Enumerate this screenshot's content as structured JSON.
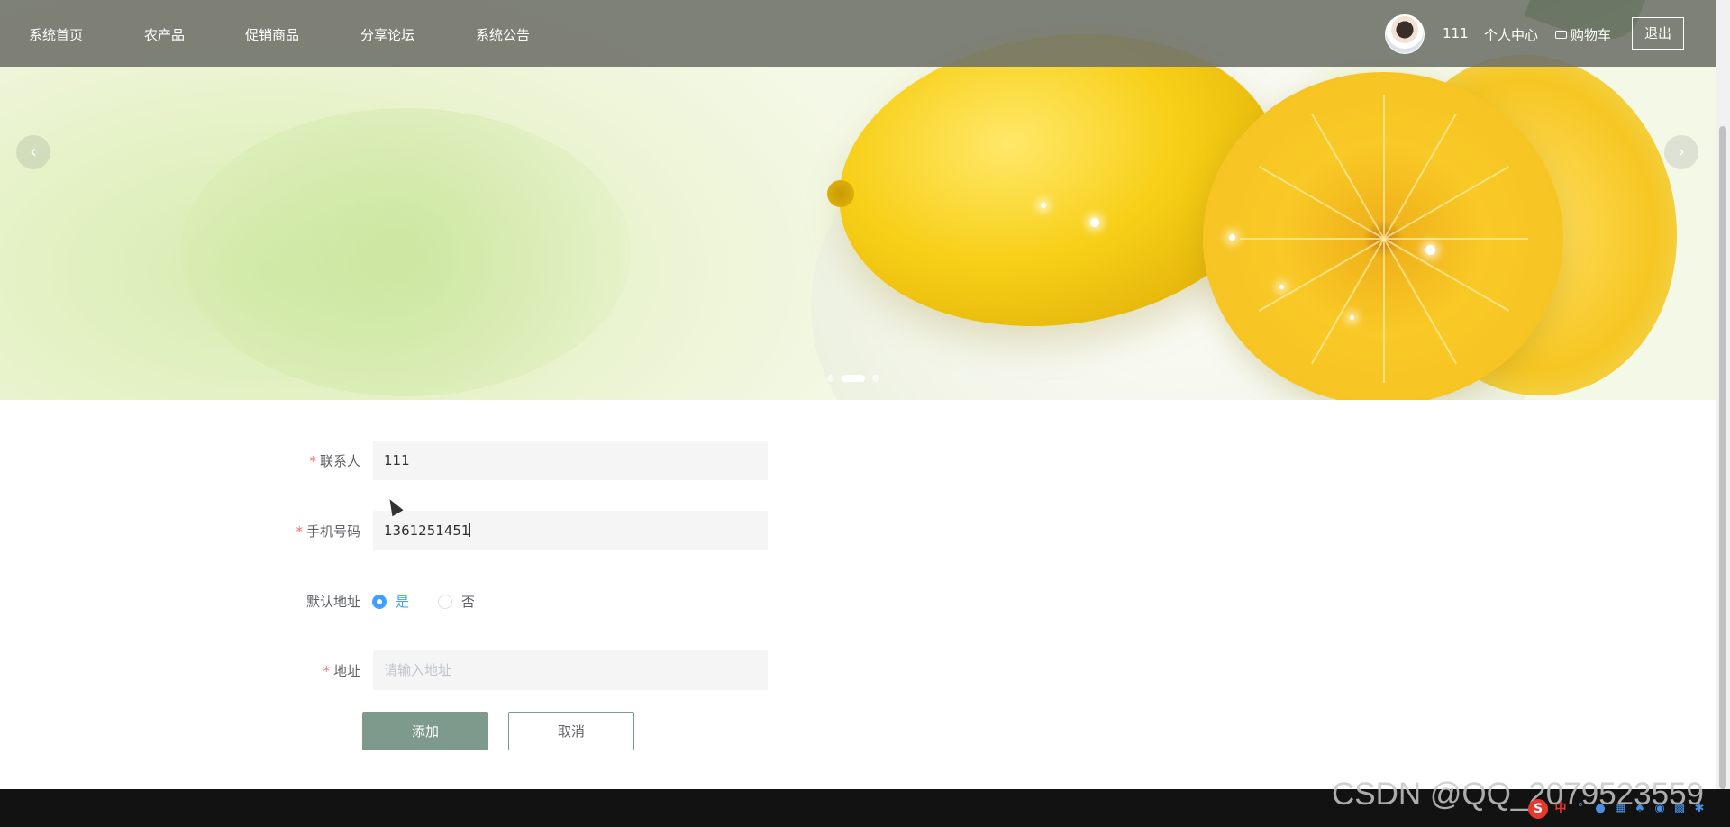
{
  "nav": {
    "items": [
      "系统首页",
      "农产品",
      "促销商品",
      "分享论坛",
      "系统公告"
    ],
    "username": "111",
    "profile_label": "个人中心",
    "cart_label": "购物车",
    "logout_label": "退出"
  },
  "carousel": {
    "prev_symbol": "‹",
    "next_symbol": "›",
    "indicator_count": 3,
    "active_index": 1
  },
  "form": {
    "contact": {
      "label": "联系人",
      "required": true,
      "value": "111"
    },
    "phone": {
      "label": "手机号码",
      "required": true,
      "value": "1361251451"
    },
    "default_address": {
      "label": "默认地址",
      "options": [
        "是",
        "否"
      ],
      "selected": "是"
    },
    "address": {
      "label": "地址",
      "required": true,
      "value": "",
      "placeholder": "请输入地址"
    },
    "submit_label": "添加",
    "cancel_label": "取消"
  },
  "watermark": "CSDN @QQ_2079523559",
  "tray": {
    "ime_label": "S",
    "ime_mode": "中",
    "icons": [
      "punctuation-icon",
      "microphone-icon",
      "keyboard-icon",
      "clothes-icon",
      "gamepad-icon",
      "grid-icon",
      "settings-icon"
    ]
  },
  "colors": {
    "nav_bg": "#71736a",
    "primary_button": "#7d9a8c",
    "radio_active": "#409eff",
    "required_star": "#f56c6c"
  }
}
